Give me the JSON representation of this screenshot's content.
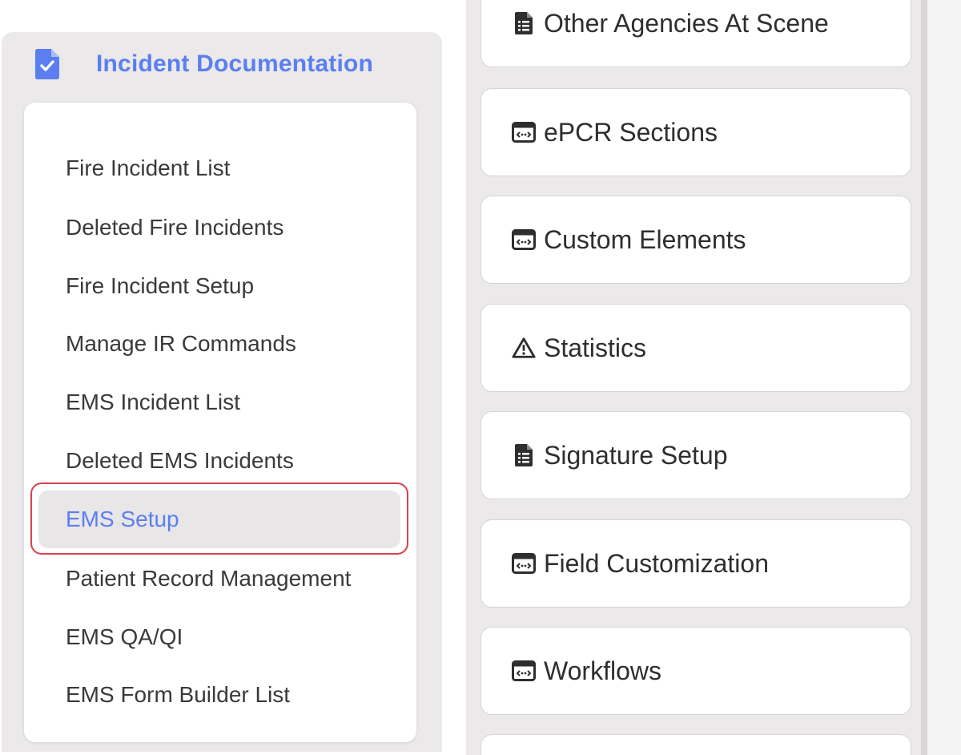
{
  "menu": {
    "title": "Incident Documentation",
    "header_icon": "document-check-icon",
    "accent_color": "#5b7ff0",
    "items": [
      {
        "label": "Fire Incident List"
      },
      {
        "label": "Deleted Fire Incidents"
      },
      {
        "label": "Fire Incident Setup"
      },
      {
        "label": "Manage IR Commands"
      },
      {
        "label": "EMS Incident List"
      },
      {
        "label": "Deleted EMS Incidents"
      },
      {
        "label": "EMS Setup",
        "active": true
      },
      {
        "label": "Patient Record Management"
      },
      {
        "label": "EMS QA/QI"
      },
      {
        "label": "EMS Form Builder List"
      }
    ]
  },
  "setup_cards": [
    {
      "label": "Other Agencies At Scene",
      "icon": "document-list-icon"
    },
    {
      "label": "ePCR Sections",
      "icon": "window-code-icon"
    },
    {
      "label": "Custom Elements",
      "icon": "window-code-icon"
    },
    {
      "label": "Statistics",
      "icon": "warning-triangle-icon"
    },
    {
      "label": "Signature Setup",
      "icon": "document-list-icon"
    },
    {
      "label": "Field Customization",
      "icon": "window-code-icon"
    },
    {
      "label": "Workflows",
      "icon": "window-code-icon"
    }
  ],
  "highlight_color": "#d9414d"
}
